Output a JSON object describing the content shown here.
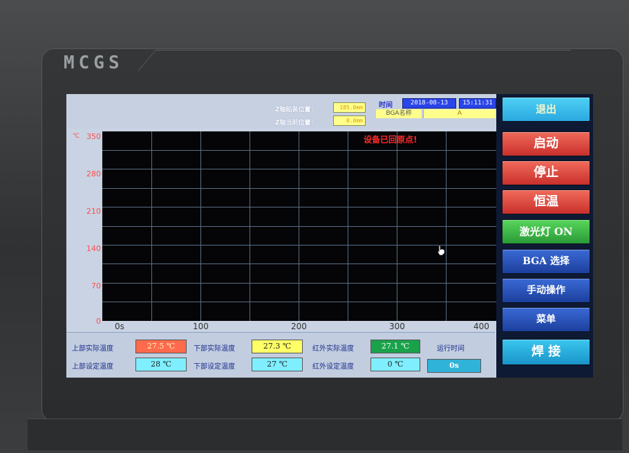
{
  "device": {
    "brand": "MCGS"
  },
  "header": {
    "z_mount_label": "Z轴贴装位置：",
    "z_mount_value": "185.0mm",
    "z_current_label": "Z轴当前位置：",
    "z_current_value": "0.0mm",
    "time_label": "时间",
    "date": "2018-08-13",
    "time": "15:11:31",
    "bga_name_label": "BGA名称",
    "bga_name_value": "A"
  },
  "chart": {
    "message": "设备已回原点!",
    "y_unit": "℃",
    "y_ticks": [
      "350",
      "280",
      "210",
      "140",
      "70",
      "0"
    ],
    "x_ticks": [
      "0s",
      "100",
      "200",
      "300",
      "400"
    ]
  },
  "chart_data": {
    "type": "line",
    "title": "",
    "xlabel": "",
    "ylabel": "℃",
    "xlim": [
      0,
      400
    ],
    "ylim": [
      0,
      350
    ],
    "grid": true,
    "series": []
  },
  "status": {
    "upper_actual_label": "上部实际温度",
    "upper_actual_value": "27.5 ℃",
    "lower_actual_label": "下部实际温度",
    "lower_actual_value": "27.3 ℃",
    "ir_actual_label": "红外实际温度",
    "ir_actual_value": "27.1 ℃",
    "runtime_label": "运行时间",
    "upper_set_label": "上部设定温度",
    "upper_set_value": "28 ℃",
    "lower_set_label": "下部设定温度",
    "lower_set_value": "27 ℃",
    "ir_set_label": "红外设定温度",
    "ir_set_value": "0 ℃",
    "runtime_value": "0s"
  },
  "sidebar": {
    "exit": "退出",
    "start": "启动",
    "stop": "停止",
    "constant_temp": "恒温",
    "laser": "激光灯 ON",
    "bga_select": "BGA 选择",
    "manual": "手动操作",
    "menu": "菜单",
    "weld": "焊 接"
  },
  "colors": {
    "plot_bg": "#050507",
    "grid": "#5a6e86",
    "axis_red": "#ff4d4d",
    "sidebar_bg": "#0e1a34"
  }
}
